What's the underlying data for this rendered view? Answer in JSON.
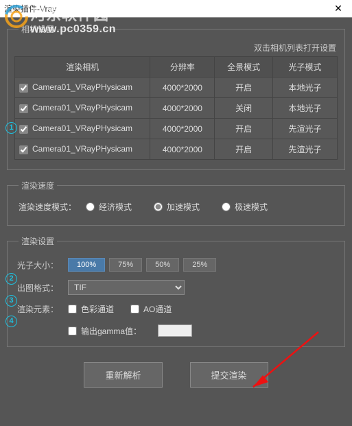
{
  "window": {
    "title": "渲染插件-Vray",
    "close": "✕"
  },
  "watermark": {
    "name": "河东软件园",
    "url": "www.pc0359.cn"
  },
  "camera": {
    "legend": "相机设置",
    "hint": "双击相机列表打开设置",
    "headers": [
      "渲染相机",
      "分辨率",
      "全景模式",
      "光子模式"
    ],
    "rows": [
      {
        "checked": true,
        "name": "Camera01_VRayPHysicam",
        "res": "4000*2000",
        "pano": "开启",
        "photon": "本地光子"
      },
      {
        "checked": true,
        "name": "Camera01_VRayPHysicam",
        "res": "4000*2000",
        "pano": "关闭",
        "photon": "本地光子"
      },
      {
        "checked": true,
        "name": "Camera01_VRayPHysicam",
        "res": "4000*2000",
        "pano": "开启",
        "photon": "先渲光子"
      },
      {
        "checked": true,
        "name": "Camera01_VRayPHysicam",
        "res": "4000*2000",
        "pano": "开启",
        "photon": "先渲光子"
      }
    ]
  },
  "speed": {
    "legend": "渲染速度",
    "label": "渲染速度模式：",
    "opts": [
      "经济模式",
      "加速模式",
      "极速模式"
    ],
    "selected": 1
  },
  "settings": {
    "legend": "渲染设置",
    "photonSize": {
      "label": "光子大小：",
      "opts": [
        "100%",
        "75%",
        "50%",
        "25%"
      ],
      "active": 0
    },
    "format": {
      "label": "出图格式：",
      "value": "TIF"
    },
    "channels": {
      "label": "渲染元素：",
      "opts": [
        "色彩通道",
        "AO通道"
      ]
    },
    "gamma": {
      "label": "输出gamma值：",
      "value": ""
    }
  },
  "footer": {
    "reparse": "重新解析",
    "submit": "提交渲染"
  },
  "annotations": [
    "1",
    "2",
    "3",
    "4"
  ]
}
